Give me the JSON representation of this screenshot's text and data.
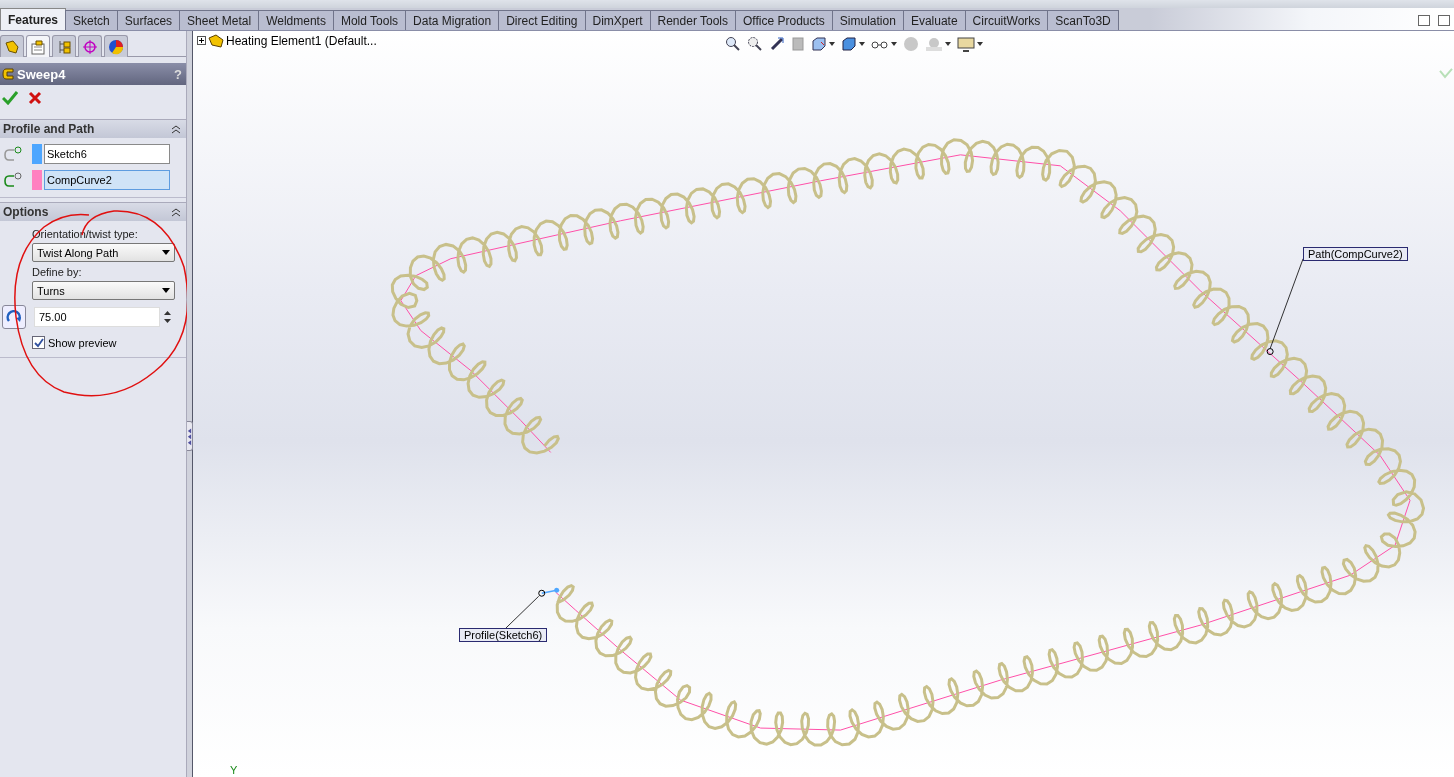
{
  "command_tabs": [
    {
      "label": "Features",
      "selected": true
    },
    {
      "label": "Sketch",
      "selected": false
    },
    {
      "label": "Surfaces",
      "selected": false
    },
    {
      "label": "Sheet Metal",
      "selected": false
    },
    {
      "label": "Weldments",
      "selected": false
    },
    {
      "label": "Mold Tools",
      "selected": false
    },
    {
      "label": "Data Migration",
      "selected": false
    },
    {
      "label": "Direct Editing",
      "selected": false
    },
    {
      "label": "DimXpert",
      "selected": false
    },
    {
      "label": "Render Tools",
      "selected": false
    },
    {
      "label": "Office Products",
      "selected": false
    },
    {
      "label": "Simulation",
      "selected": false
    },
    {
      "label": "Evaluate",
      "selected": false
    },
    {
      "label": "CircuitWorks",
      "selected": false
    },
    {
      "label": "ScanTo3D",
      "selected": false
    }
  ],
  "panel_tabs": [
    {
      "kind": "feature",
      "selected": false
    },
    {
      "kind": "property",
      "selected": true
    },
    {
      "kind": "config",
      "selected": false
    },
    {
      "kind": "dimxpert",
      "selected": false
    },
    {
      "kind": "display",
      "selected": false
    }
  ],
  "property_manager": {
    "title": "Sweep4",
    "help": "?",
    "sections": [
      {
        "kind": "selections",
        "title": "Profile and Path",
        "fields": [
          {
            "value": "Sketch6",
            "color": "#4da6ff",
            "selected": false
          },
          {
            "value": "CompCurve2",
            "color": "#ff80c0",
            "selected": true
          }
        ]
      },
      {
        "kind": "options",
        "title": "Options",
        "twist_label": "Orientation/twist type:",
        "twist_value": "Twist Along Path",
        "define_label": "Define by:",
        "define_value": "Turns",
        "turns": "75.00",
        "preview_label": "Show preview",
        "preview_checked": true
      }
    ]
  },
  "feature_tree": {
    "label": "Heating Element1  (Default...",
    "expanded": false
  },
  "viewport": {
    "path_label": "Path(CompCurve2)",
    "profile_label": "Profile(Sketch6)",
    "axis_label": "Y"
  }
}
